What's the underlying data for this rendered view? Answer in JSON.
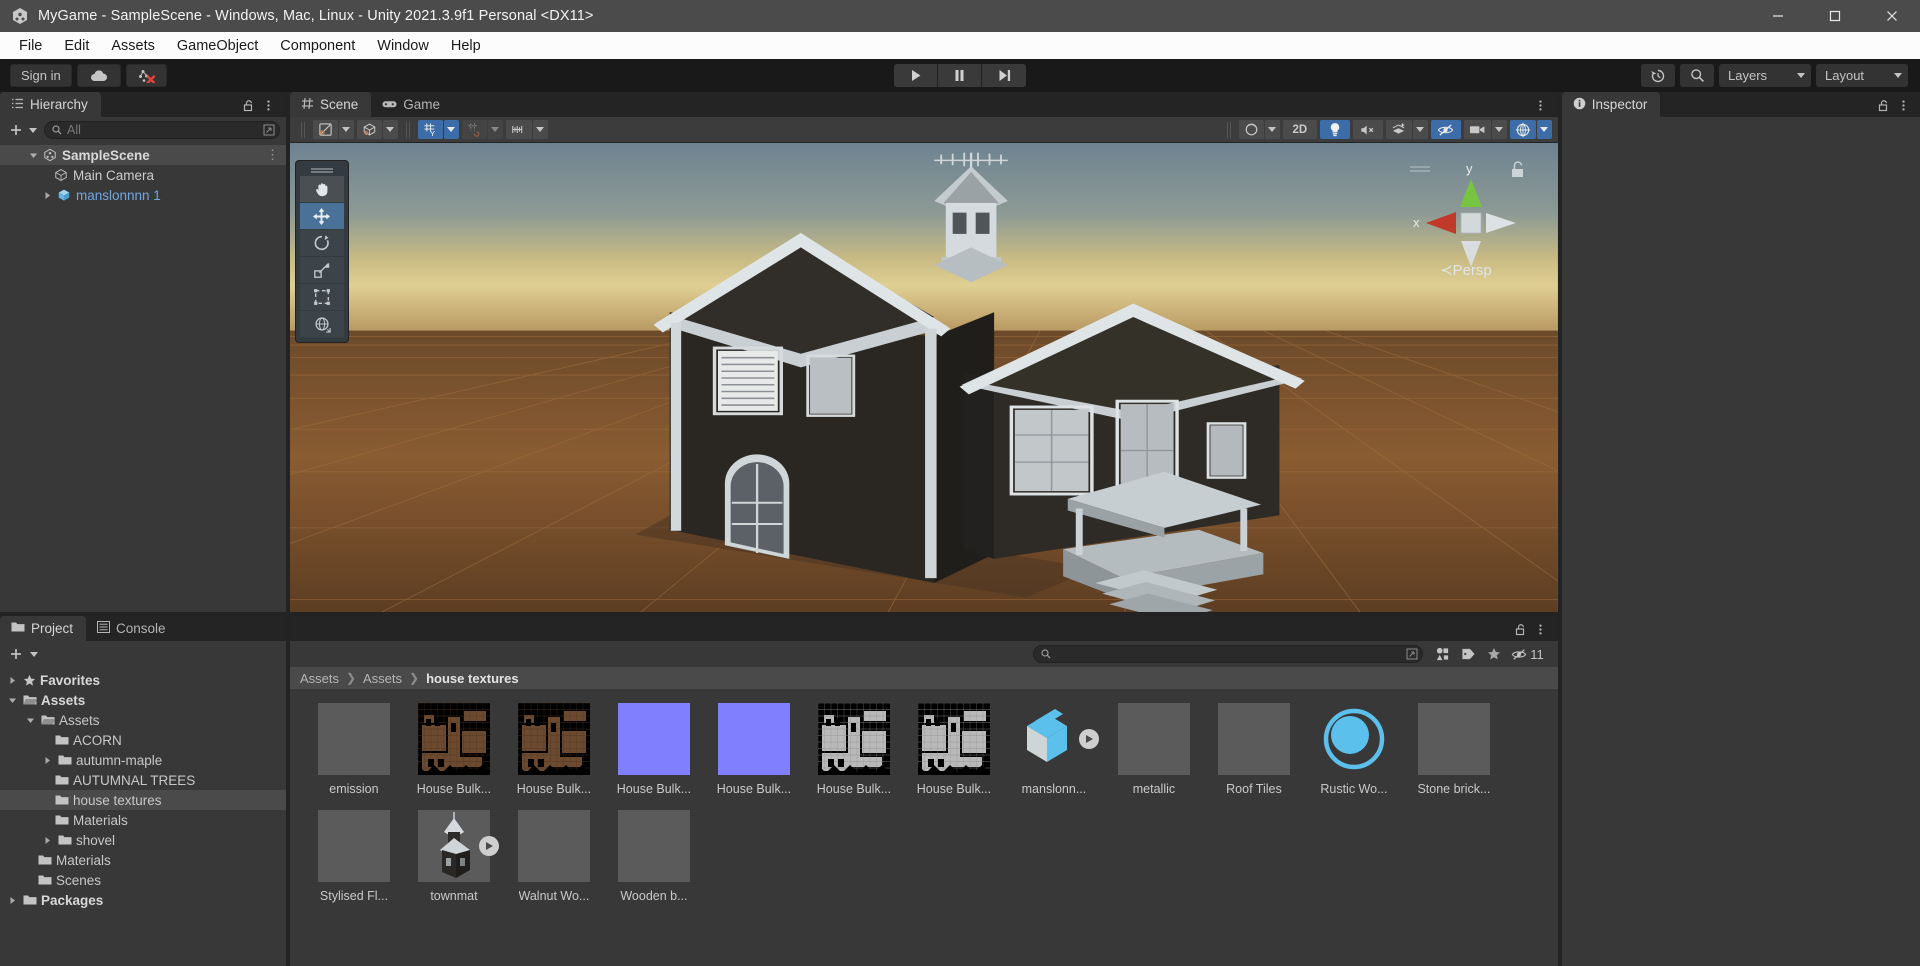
{
  "window": {
    "title": "MyGame - SampleScene - Windows, Mac, Linux - Unity 2021.3.9f1 Personal <DX11>",
    "app_icon": "unity-icon",
    "minimize": "minimize-icon",
    "maximize": "maximize-icon",
    "close": "close-icon"
  },
  "menubar": {
    "items": [
      {
        "label": "File"
      },
      {
        "label": "Edit"
      },
      {
        "label": "Assets"
      },
      {
        "label": "GameObject"
      },
      {
        "label": "Component"
      },
      {
        "label": "Window"
      },
      {
        "label": "Help"
      }
    ]
  },
  "toolbar": {
    "sign_in_label": "Sign in",
    "cloud_icon": "cloud-icon",
    "collab_icon": "collab-error-icon",
    "play_label": "play-icon",
    "pause_label": "pause-icon",
    "step_label": "step-icon",
    "history_icon": "undo-history-icon",
    "search_icon": "search-icon",
    "layers_label": "Layers",
    "layout_label": "Layout"
  },
  "hierarchy": {
    "tab_label": "Hierarchy",
    "tab_icon": "hierarchy-icon",
    "lock_icon": "lock-open-icon",
    "menu_icon": "kebab-menu-icon",
    "add_label": "add-icon",
    "search_placeholder": "All",
    "search_value": "",
    "items": [
      {
        "label": "SampleScene",
        "icon": "unity-scene-icon",
        "indent": 0,
        "expanded": true,
        "selected": true,
        "kind": "scene"
      },
      {
        "label": "Main Camera",
        "icon": "gameobject-icon",
        "indent": 1,
        "expanded": null,
        "selected": false,
        "kind": "object"
      },
      {
        "label": "manslonnnn 1",
        "icon": "prefab-icon",
        "indent": 1,
        "expanded": false,
        "selected": false,
        "kind": "prefab"
      }
    ]
  },
  "scene": {
    "tabs": [
      {
        "label": "Scene",
        "icon": "scene-grid-icon",
        "active": true
      },
      {
        "label": "Game",
        "icon": "gamepad-icon",
        "active": false
      }
    ],
    "menu_icon": "kebab-menu-icon",
    "toolbar": {
      "shading_mode_icon": "shaded-mode-icon",
      "draw_mode_icon": "2d-wire-icon",
      "lighting_icon": "lighting-icon",
      "two_d_label": "2D",
      "audio_icon": "audio-mute-icon",
      "fx_icon": "effects-icon",
      "hidden_icon": "visibility-off-icon",
      "camera_icon": "scene-camera-icon",
      "gizmos_icon": "gizmos-icon"
    },
    "tools_overlay": [
      {
        "icon": "hand-tool-icon",
        "active": false
      },
      {
        "icon": "move-tool-icon",
        "active": true
      },
      {
        "icon": "rotate-tool-icon",
        "active": false
      },
      {
        "icon": "scale-tool-icon",
        "active": false
      },
      {
        "icon": "rect-tool-icon",
        "active": false
      },
      {
        "icon": "transform-tool-icon",
        "active": false
      }
    ],
    "gizmo": {
      "x_label": "x",
      "y_label": "y",
      "persp_label": "Persp",
      "lock_icon": "lock-open-icon"
    }
  },
  "inspector": {
    "tab_label": "Inspector",
    "tab_icon": "info-icon",
    "lock_icon": "lock-open-icon",
    "menu_icon": "kebab-menu-icon"
  },
  "project": {
    "tabs": [
      {
        "label": "Project",
        "icon": "folder-icon",
        "active": true
      },
      {
        "label": "Console",
        "icon": "console-icon",
        "active": false
      }
    ],
    "lock_icon": "lock-open-icon",
    "menu_icon": "kebab-menu-icon",
    "add_label": "add-icon",
    "search_placeholder": "",
    "search_value": "",
    "filter_type_icon": "filter-type-icon",
    "filter_label_icon": "filter-label-icon",
    "favorite_icon": "star-icon",
    "hidden_count": "11",
    "hidden_icon": "visibility-off-icon",
    "tree": [
      {
        "label": "Favorites",
        "indent": 0,
        "twisty": "collapsed",
        "icon": "star-icon",
        "bold": true,
        "selected": false
      },
      {
        "label": "Assets",
        "indent": 0,
        "twisty": "expanded",
        "icon": "folder-open-icon",
        "bold": true,
        "selected": false
      },
      {
        "label": "Assets",
        "indent": 1,
        "twisty": "expanded",
        "icon": "folder-open-icon",
        "bold": false,
        "selected": false
      },
      {
        "label": "ACORN",
        "indent": 2,
        "twisty": "none",
        "icon": "folder-icon",
        "bold": false,
        "selected": false
      },
      {
        "label": "autumn-maple",
        "indent": 2,
        "twisty": "collapsed",
        "icon": "folder-icon",
        "bold": false,
        "selected": false
      },
      {
        "label": "AUTUMNAL TREES",
        "indent": 2,
        "twisty": "none",
        "icon": "folder-icon",
        "bold": false,
        "selected": false
      },
      {
        "label": "house textures",
        "indent": 2,
        "twisty": "none",
        "icon": "folder-icon",
        "bold": false,
        "selected": true
      },
      {
        "label": "Materials",
        "indent": 2,
        "twisty": "none",
        "icon": "folder-icon",
        "bold": false,
        "selected": false
      },
      {
        "label": "shovel",
        "indent": 2,
        "twisty": "collapsed",
        "icon": "folder-icon",
        "bold": false,
        "selected": false
      },
      {
        "label": "Materials",
        "indent": 1,
        "twisty": "none",
        "icon": "folder-icon",
        "bold": false,
        "selected": false
      },
      {
        "label": "Scenes",
        "indent": 1,
        "twisty": "none",
        "icon": "folder-icon",
        "bold": false,
        "selected": false
      },
      {
        "label": "Packages",
        "indent": 0,
        "twisty": "collapsed",
        "icon": "folder-icon",
        "bold": true,
        "selected": false
      }
    ],
    "breadcrumb": [
      {
        "label": "Assets",
        "current": false
      },
      {
        "label": "Assets",
        "current": false
      },
      {
        "label": "house textures",
        "current": true
      }
    ],
    "assets": [
      {
        "label": "emission",
        "thumb": "sphere",
        "color": "#c9c9c9",
        "badge": false
      },
      {
        "label": "House Bulk...",
        "thumb": "texture-brown",
        "color": "#6b4a30",
        "badge": false
      },
      {
        "label": "House Bulk...",
        "thumb": "texture-brown",
        "color": "#6b4a30",
        "badge": false
      },
      {
        "label": "House Bulk...",
        "thumb": "flat",
        "color": "#8080ff",
        "badge": false
      },
      {
        "label": "House Bulk...",
        "thumb": "flat",
        "color": "#8080ff",
        "badge": false
      },
      {
        "label": "House Bulk...",
        "thumb": "texture-grey",
        "color": "#bdbdbd",
        "badge": false
      },
      {
        "label": "House Bulk...",
        "thumb": "texture-grey",
        "color": "#bdbdbd",
        "badge": false
      },
      {
        "label": "manslonn...",
        "thumb": "prefab-box",
        "color": "#5bc0eb",
        "badge": true
      },
      {
        "label": "metallic",
        "thumb": "sphere",
        "color": "#1a1a1a",
        "badge": false
      },
      {
        "label": "Roof Tiles",
        "thumb": "sphere",
        "color": "#c9c9c9",
        "badge": false
      },
      {
        "label": "Rustic Wo...",
        "thumb": "shader-ball",
        "color": "#5bc0eb",
        "badge": false
      },
      {
        "label": "Stone brick...",
        "thumb": "sphere",
        "color": "#9b9b9b",
        "badge": false
      },
      {
        "label": "Stylised Fl...",
        "thumb": "sphere",
        "color": "#c9c9c9",
        "badge": false
      },
      {
        "label": "townmat",
        "thumb": "model-house",
        "color": "#4a4a4a",
        "badge": true
      },
      {
        "label": "Walnut Wo...",
        "thumb": "sphere",
        "color": "#b88a4e",
        "badge": false
      },
      {
        "label": "Wooden b...",
        "thumb": "sphere",
        "color": "#b4b4b4",
        "badge": false
      }
    ]
  },
  "colors": {
    "accent_blue": "#3c6da8",
    "prefab_blue": "#72a6e0",
    "panel_bg": "#383838",
    "chrome_dark": "#242424"
  }
}
